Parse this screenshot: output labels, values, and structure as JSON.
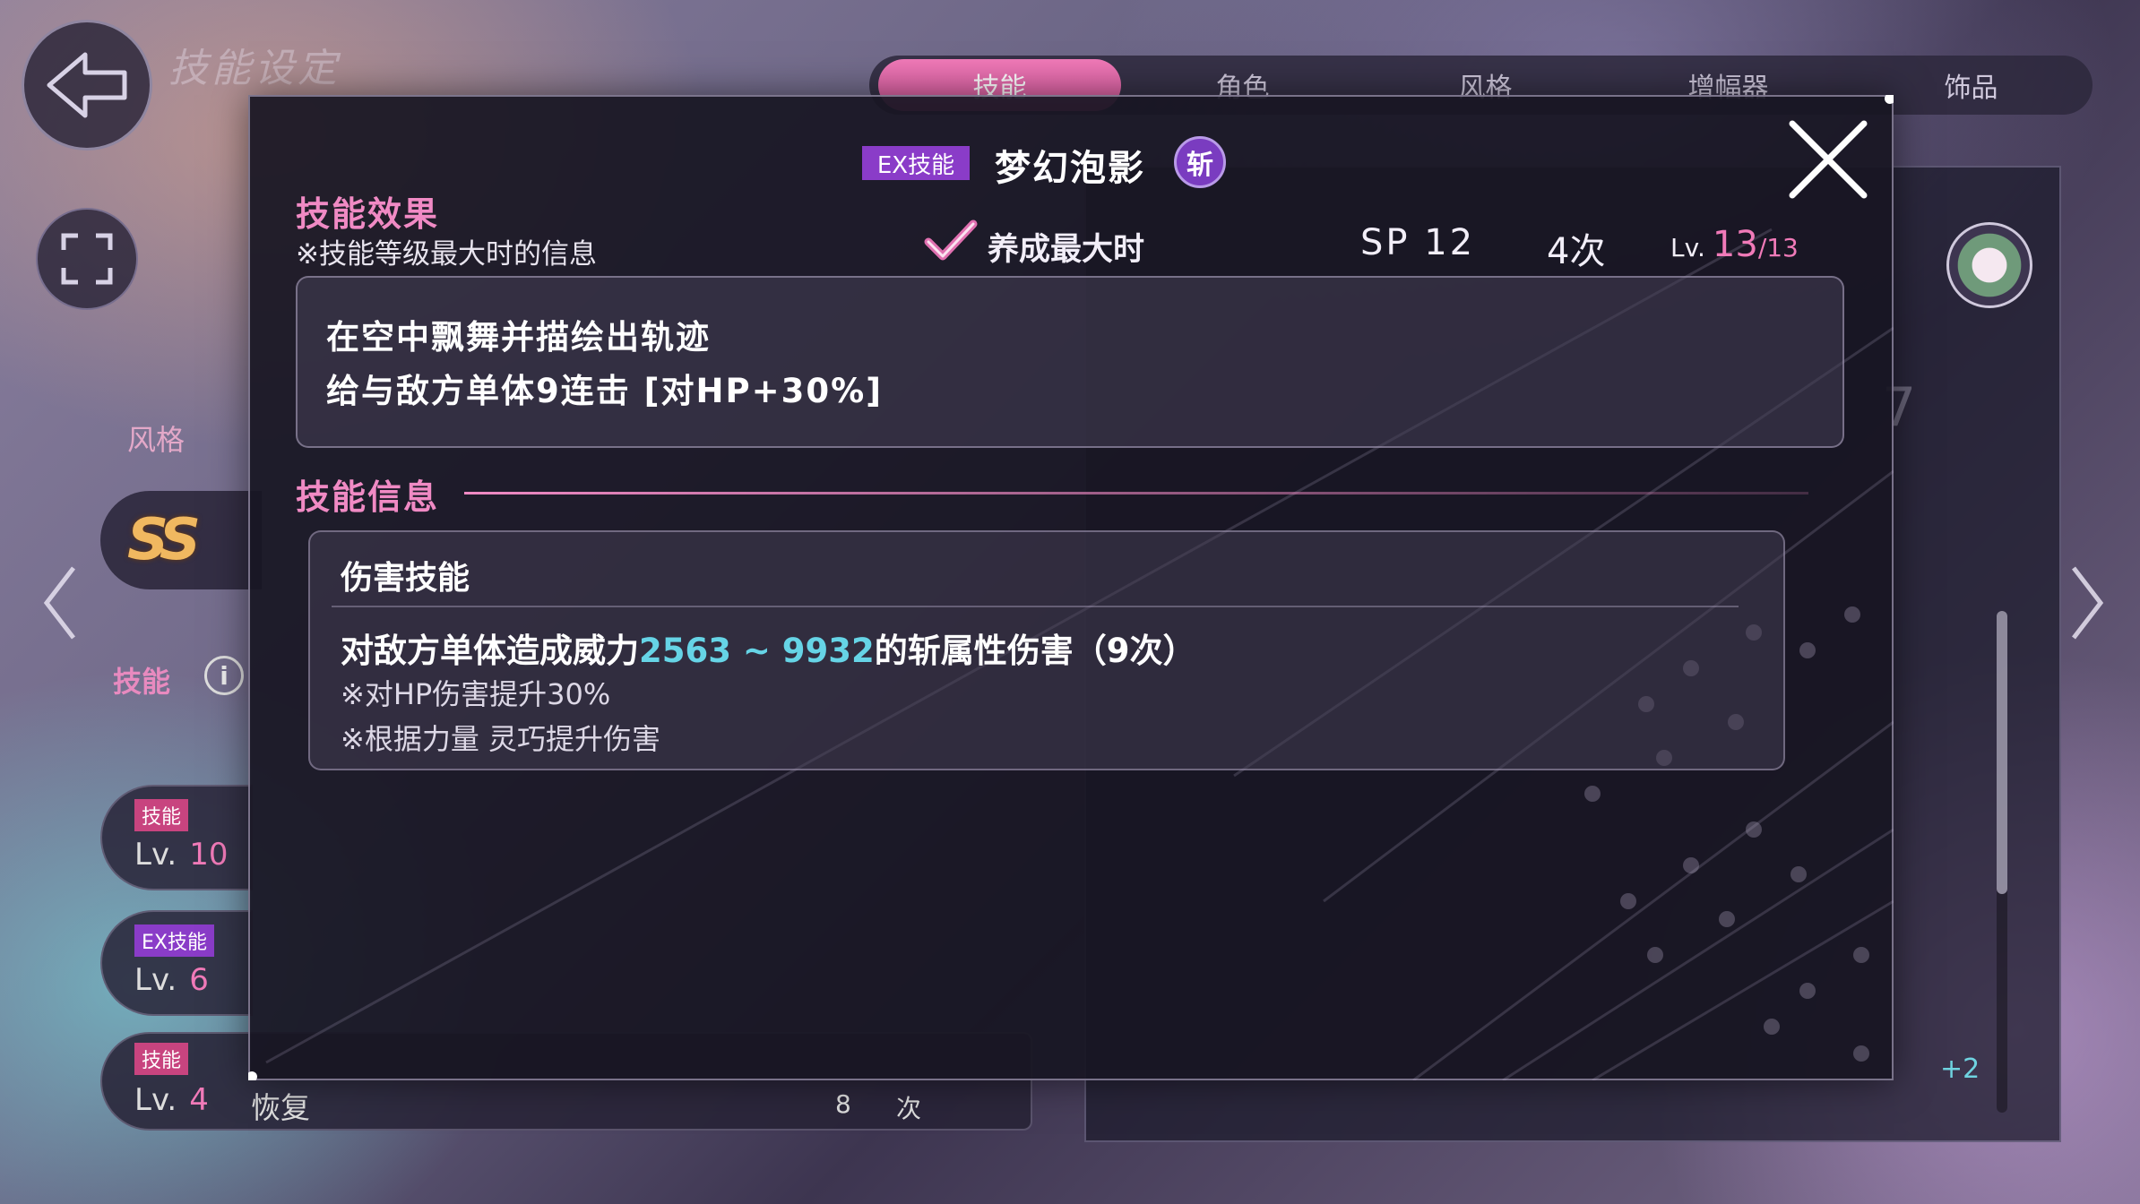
{
  "screen": {
    "title": "技能设定"
  },
  "tabs": [
    {
      "label": "技能",
      "active": true
    },
    {
      "label": "角色",
      "active": false
    },
    {
      "label": "风格",
      "active": false
    },
    {
      "label": "增幅器",
      "active": false
    },
    {
      "label": "饰品",
      "active": false
    }
  ],
  "left_panel": {
    "style_label": "风格",
    "style_rank": "SS",
    "skill_label": "技能",
    "info_icon": "i",
    "slots": [
      {
        "tag": "技能",
        "tag_color": "#c8447f",
        "lv_prefix": "Lv.",
        "lv": "10"
      },
      {
        "tag": "EX技能",
        "tag_color": "#8a3cc8",
        "lv_prefix": "Lv.",
        "lv": "6"
      },
      {
        "tag": "技能",
        "tag_color": "#c8447f",
        "lv_prefix": "Lv.",
        "lv": "4"
      }
    ],
    "bottom": {
      "type": "恢复",
      "count": "8",
      "unit": "次"
    }
  },
  "right_panel": {
    "partial_number": "7",
    "bonus": "+2"
  },
  "modal": {
    "ex_tag": "EX技能",
    "skill_name": "梦幻泡影",
    "attribute": "斩",
    "effect_title": "技能效果",
    "effect_note": "※技能等级最大时的信息",
    "max_toggle_label": "养成最大时",
    "sp": "SP 12",
    "uses": "4次",
    "lv_prefix": "Lv.",
    "lv_current": "13",
    "lv_max": "/13",
    "description": [
      "在空中飘舞并描绘出轨迹",
      "给与敌方单体9连击 [对HP+30%]"
    ],
    "info_title": "技能信息",
    "damage": {
      "heading": "伤害技能",
      "line_prefix": "对敌方单体造成威力",
      "range": "2563 ~ 9932",
      "line_suffix": "的斩属性伤害（9次）",
      "notes": [
        "※对HP伤害提升30%",
        "※根据力量 灵巧提升伤害"
      ]
    }
  },
  "colors": {
    "accent_pink": "#f08ac4",
    "ex_purple": "#8a3cc8",
    "range_cyan": "#66d4e6"
  },
  "icons": {
    "back": "arrow-left-icon",
    "expand": "expand-icon",
    "close": "close-x-icon",
    "check": "checkmark-icon",
    "emblem": "flower-emblem-icon",
    "prev": "chevron-left-icon",
    "next": "chevron-right-icon"
  }
}
